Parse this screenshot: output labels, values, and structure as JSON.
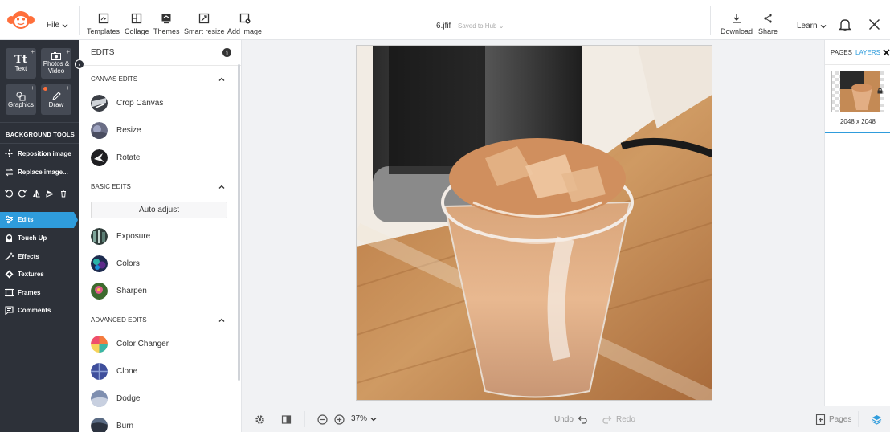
{
  "topbar": {
    "file_label": "File",
    "tools": [
      {
        "label": "Templates",
        "icon": "templates-icon"
      },
      {
        "label": "Collage",
        "icon": "collage-icon"
      },
      {
        "label": "Themes",
        "icon": "themes-icon"
      },
      {
        "label": "Smart resize",
        "icon": "smart-resize-icon"
      },
      {
        "label": "Add image",
        "icon": "add-image-icon"
      }
    ],
    "doc_title": "6.jfif",
    "saved_status": "Saved to Hub",
    "download_label": "Download",
    "share_label": "Share",
    "learn_label": "Learn"
  },
  "sidebar": {
    "tiles": [
      {
        "label": "Text",
        "icon": "text-icon"
      },
      {
        "label": "Photos & Video",
        "icon": "photos-icon"
      },
      {
        "label": "Graphics",
        "icon": "graphics-icon"
      },
      {
        "label": "Draw",
        "icon": "draw-icon"
      }
    ],
    "background_heading": "BACKGROUND TOOLS",
    "reposition_label": "Reposition image",
    "replace_label": "Replace image...",
    "nav": [
      {
        "label": "Edits",
        "icon": "edits-icon"
      },
      {
        "label": "Touch Up",
        "icon": "touch-up-icon"
      },
      {
        "label": "Effects",
        "icon": "effects-icon"
      },
      {
        "label": "Textures",
        "icon": "textures-icon"
      },
      {
        "label": "Frames",
        "icon": "frames-icon"
      },
      {
        "label": "Comments",
        "icon": "comments-icon"
      }
    ]
  },
  "panel": {
    "title": "EDITS",
    "sections": [
      {
        "title": "CANVAS EDITS",
        "items": [
          "Crop Canvas",
          "Resize",
          "Rotate"
        ]
      },
      {
        "title": "BASIC EDITS",
        "button": "Auto adjust",
        "items": [
          "Exposure",
          "Colors",
          "Sharpen"
        ]
      },
      {
        "title": "ADVANCED EDITS",
        "items": [
          "Color Changer",
          "Clone",
          "Dodge",
          "Burn"
        ]
      }
    ]
  },
  "bottombar": {
    "zoom": "37%",
    "undo_label": "Undo",
    "redo_label": "Redo",
    "pages_label": "Pages"
  },
  "right_panel": {
    "pages_tab": "PAGES",
    "layers_tab": "LAYERS",
    "layer_size": "2048 x 2048"
  },
  "colors": {
    "accent": "#2f9cdc",
    "sidebar_bg": "#2d3139",
    "brand": "#ff6f3b"
  }
}
